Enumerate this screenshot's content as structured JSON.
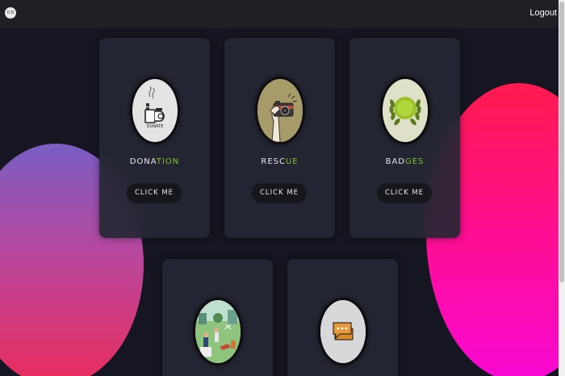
{
  "navbar": {
    "avatar_text": "ICB",
    "logout_label": "Logout"
  },
  "cards": [
    {
      "title_white": "DONA",
      "title_green": "TION",
      "button_label": "CLICK ME",
      "icon_text": "DONATE"
    },
    {
      "title_white": "RESC",
      "title_green": "UE",
      "button_label": "CLICK ME"
    },
    {
      "title_white": "BAD",
      "title_green": "GES",
      "button_label": "CLICK ME"
    },
    {
      "title_white": "",
      "title_green": ""
    },
    {
      "title_white": "",
      "title_green": ""
    }
  ],
  "colors": {
    "background": "#151621",
    "card": "#262734",
    "accent_green": "#7dc32b",
    "blob_left_top": "#7a5ec4",
    "blob_left_bottom": "#ea2c5c",
    "blob_right_top": "#ff1a4e",
    "blob_right_bottom": "#f708d4"
  }
}
